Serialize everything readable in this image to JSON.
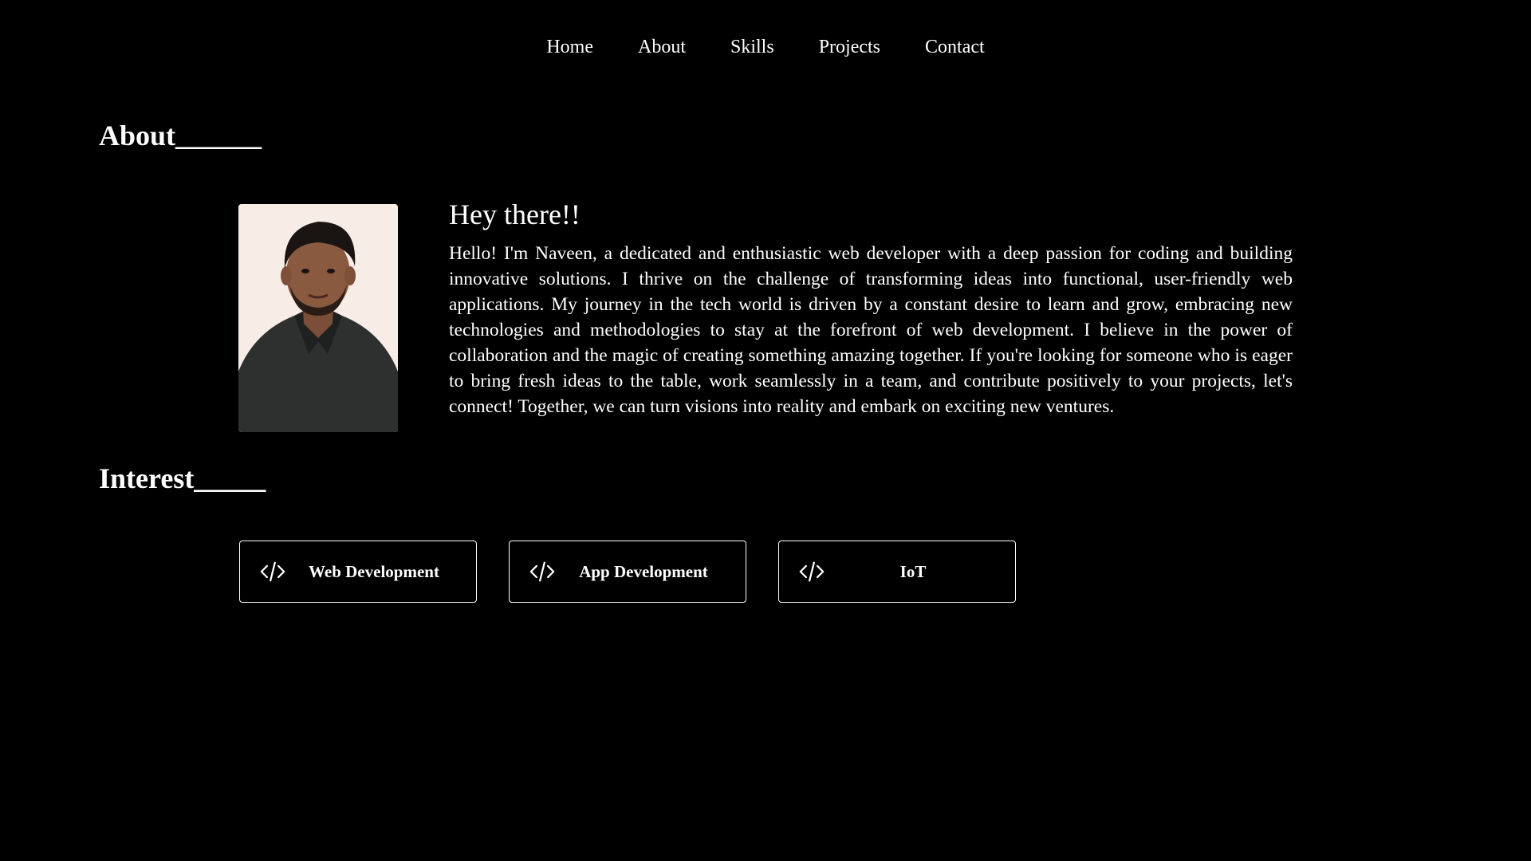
{
  "nav": {
    "items": [
      {
        "label": "Home"
      },
      {
        "label": "About"
      },
      {
        "label": "Skills"
      },
      {
        "label": "Projects"
      },
      {
        "label": "Contact"
      }
    ]
  },
  "about": {
    "title": "About______",
    "greeting": "Hey there!!",
    "bio": "Hello! I'm Naveen, a dedicated and enthusiastic web developer with a deep passion for coding and building innovative solutions. I thrive on the challenge of transforming ideas into functional, user-friendly web applications. My journey in the tech world is driven by a constant desire to learn and grow, embracing new technologies and methodologies to stay at the forefront of web development. I believe in the power of collaboration and the magic of creating something amazing together. If you're looking for someone who is eager to bring fresh ideas to the table, work seamlessly in a team, and contribute positively to your projects, let's connect! Together, we can turn visions into reality and embark on exciting new ventures."
  },
  "interest": {
    "title": "Interest_____",
    "cards": [
      {
        "label": "Web Development",
        "icon": "code-icon"
      },
      {
        "label": "App Development",
        "icon": "code-icon"
      },
      {
        "label": "IoT",
        "icon": "code-icon"
      }
    ]
  },
  "colors": {
    "background": "#000000",
    "text": "#ffffff"
  }
}
